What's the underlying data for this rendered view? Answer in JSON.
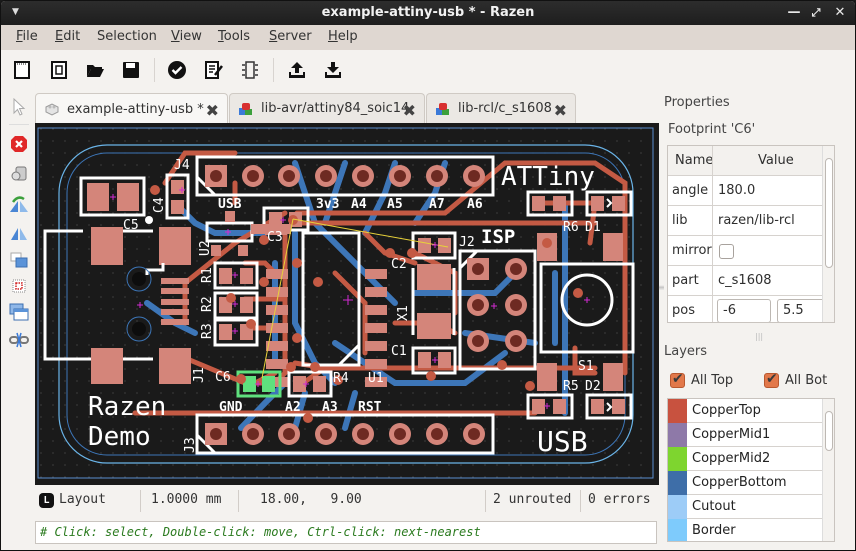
{
  "window": {
    "title": "example-attiny-usb * - Razen",
    "controls": [
      "minimize",
      "maximize",
      "close"
    ]
  },
  "menubar": {
    "items": [
      {
        "label": "File",
        "mnemonic": "F",
        "rest": "ile"
      },
      {
        "label": "Edit",
        "mnemonic": "E",
        "rest": "dit"
      },
      {
        "label": "Selection",
        "mnemonic": "",
        "rest": "Selection"
      },
      {
        "label": "View",
        "mnemonic": "V",
        "rest": "iew"
      },
      {
        "label": "Tools",
        "mnemonic": "T",
        "rest": "ools"
      },
      {
        "label": "Server",
        "mnemonic": "S",
        "rest": "erver"
      },
      {
        "label": "Help",
        "mnemonic": "H",
        "rest": "elp"
      }
    ]
  },
  "toolbar": {
    "items": [
      "new-document-icon",
      "new-footprint-icon",
      "open-folder-icon",
      "save-icon",
      "check-icon",
      "edit-properties-icon",
      "chip-icon",
      "upload-icon",
      "download-icon"
    ]
  },
  "left_tools": [
    "select-arrow-icon",
    "delete-icon",
    "rotate-icon",
    "flip-rotate-icon",
    "mirror-icon",
    "move-to-back-icon",
    "select-region-icon",
    "windows-icon",
    "unlink-icon"
  ],
  "tabs": [
    {
      "label": "example-attiny-usb *",
      "icon": "layout-gray-icon",
      "active": true
    },
    {
      "label": "lib-avr/attiny84_soic14",
      "icon": "footprint-color-icon",
      "active": false
    },
    {
      "label": "lib-rcl/c_s1608",
      "icon": "footprint-color-icon",
      "active": false
    }
  ],
  "pcb": {
    "labels": {
      "j4": "J4",
      "c4": "C4",
      "c5": "C5",
      "usb_top": "USB",
      "v33": "3v3",
      "a4": "A4",
      "a5": "A5",
      "a7": "A7",
      "a6": "A6",
      "attiny": "ATTiny",
      "c3": "C3",
      "u2": "U2",
      "isp": "ISP",
      "j2": "J2",
      "c2": "C2",
      "r6": "R6",
      "d1": "D1",
      "r1": "R1",
      "r2": "R2",
      "r3": "R3",
      "x1": "X1",
      "c1": "C1",
      "s1": "S1",
      "j1": "J1",
      "c6": "C6",
      "r4": "R4",
      "u1": "U1",
      "r5": "R5",
      "d2": "D2",
      "gnd": "GND",
      "a2": "A2",
      "a3": "A3",
      "rst": "RST",
      "razen": "Razen",
      "demo": "Demo",
      "j3": "J3",
      "usb_bottom": "USB"
    },
    "colors": {
      "background": "#1a1a1a",
      "copper_top": "#c45a44",
      "pad": "#d4857a",
      "copper_bottom": "#3d76b8",
      "silkscreen": "#ffffff",
      "border": "#6ab4e8",
      "selected": "#5fe07e",
      "ratsnest": "#e8d23a",
      "origin": "#d22bd2"
    }
  },
  "status": {
    "mode_icon": "L",
    "mode": "Layout",
    "grid": "1.0000 mm",
    "coords": "18.00,   9.00",
    "unrouted": "2 unrouted",
    "errors": "0 errors"
  },
  "command_line": "# Click: select, Double-click: move, Ctrl-click: next-nearest",
  "properties": {
    "heading": "Properties",
    "subtitle": "Footprint 'C6'",
    "col_name": "Name",
    "col_value": "Value",
    "rows": [
      {
        "name": "angle",
        "value": "180.0"
      },
      {
        "name": "lib",
        "value": "razen/lib-rcl"
      },
      {
        "name": "mirror",
        "value": "",
        "checked": false
      },
      {
        "name": "part",
        "value": "c_s1608"
      },
      {
        "name": "pos",
        "x": "-6",
        "y": "5.5"
      }
    ]
  },
  "layers": {
    "heading": "Layers",
    "all_top": {
      "label": "All Top",
      "checked": true
    },
    "all_bot": {
      "label": "All Bot",
      "checked": true
    },
    "items": [
      {
        "name": "CopperTop",
        "color": "#c8523f"
      },
      {
        "name": "CopperMid1",
        "color": "#8e79a8"
      },
      {
        "name": "CopperMid2",
        "color": "#7ed52f"
      },
      {
        "name": "CopperBottom",
        "color": "#3e6ea8"
      },
      {
        "name": "Cutout",
        "color": "#9dccf7"
      },
      {
        "name": "Border",
        "color": "#7ecbfc"
      }
    ]
  }
}
